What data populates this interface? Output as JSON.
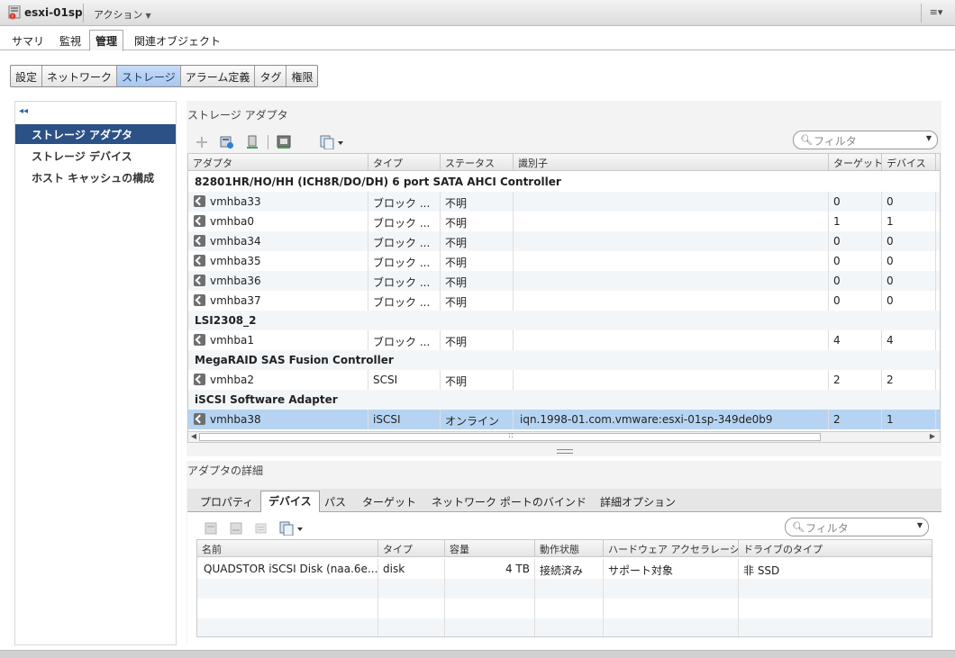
{
  "titlebar": {
    "host": "esxi-01sp",
    "actions_label": "アクション",
    "caret": "▼",
    "menu_icon": "≡▾"
  },
  "main_tabs": [
    "サマリ",
    "監視",
    "管理",
    "関連オブジェクト"
  ],
  "sub_tabs": [
    "設定",
    "ネットワーク",
    "ストレージ",
    "アラーム定義",
    "タグ",
    "権限"
  ],
  "leftnav": {
    "collapse": "◂◂",
    "items": [
      "ストレージ アダプタ",
      "ストレージ デバイス",
      "ホスト キャッシュの構成"
    ]
  },
  "adapters": {
    "title": "ストレージ アダプタ",
    "filter_placeholder": "フィルタ",
    "columns": [
      "アダプタ",
      "タイプ",
      "ステータス",
      "識別子",
      "ターゲット",
      "デバイス"
    ],
    "groups": [
      {
        "name": "82801HR/HO/HH (ICH8R/DO/DH) 6 port SATA AHCI Controller",
        "rows": [
          {
            "adapter": "vmhba33",
            "type": "ブロック ...",
            "status": "不明",
            "id": "",
            "targets": "0",
            "devices": "0"
          },
          {
            "adapter": "vmhba0",
            "type": "ブロック ...",
            "status": "不明",
            "id": "",
            "targets": "1",
            "devices": "1"
          },
          {
            "adapter": "vmhba34",
            "type": "ブロック ...",
            "status": "不明",
            "id": "",
            "targets": "0",
            "devices": "0"
          },
          {
            "adapter": "vmhba35",
            "type": "ブロック ...",
            "status": "不明",
            "id": "",
            "targets": "0",
            "devices": "0"
          },
          {
            "adapter": "vmhba36",
            "type": "ブロック ...",
            "status": "不明",
            "id": "",
            "targets": "0",
            "devices": "0"
          },
          {
            "adapter": "vmhba37",
            "type": "ブロック ...",
            "status": "不明",
            "id": "",
            "targets": "0",
            "devices": "0"
          }
        ]
      },
      {
        "name": "LSI2308_2",
        "rows": [
          {
            "adapter": "vmhba1",
            "type": "ブロック ...",
            "status": "不明",
            "id": "",
            "targets": "4",
            "devices": "4"
          }
        ]
      },
      {
        "name": "MegaRAID SAS Fusion Controller",
        "rows": [
          {
            "adapter": "vmhba2",
            "type": "SCSI",
            "status": "不明",
            "id": "",
            "targets": "2",
            "devices": "2"
          }
        ]
      },
      {
        "name": "iSCSI Software Adapter",
        "rows": [
          {
            "adapter": "vmhba38",
            "type": "iSCSI",
            "status": "オンライン",
            "id": "iqn.1998-01.com.vmware:esxi-01sp-349de0b9",
            "targets": "2",
            "devices": "1",
            "selected": true
          }
        ]
      }
    ],
    "scroll_mid": "::"
  },
  "details": {
    "title": "アダプタの詳細",
    "tabs": [
      "プロパティ",
      "デバイス",
      "パス",
      "ターゲット",
      "ネットワーク ポートのバインド",
      "詳細オプション"
    ],
    "filter_placeholder": "フィルタ",
    "columns": [
      "名前",
      "タイプ",
      "容量",
      "動作状態",
      "ハードウェア アクセラレーシ...",
      "ドライブのタイプ"
    ],
    "rows": [
      {
        "name": "QUADSTOR iSCSI Disk (naa.6e...",
        "type": "disk",
        "capacity": "4 TB",
        "state": "接続済み",
        "hw_accel": "サポート対象",
        "drive_type": "非 SSD"
      }
    ]
  }
}
